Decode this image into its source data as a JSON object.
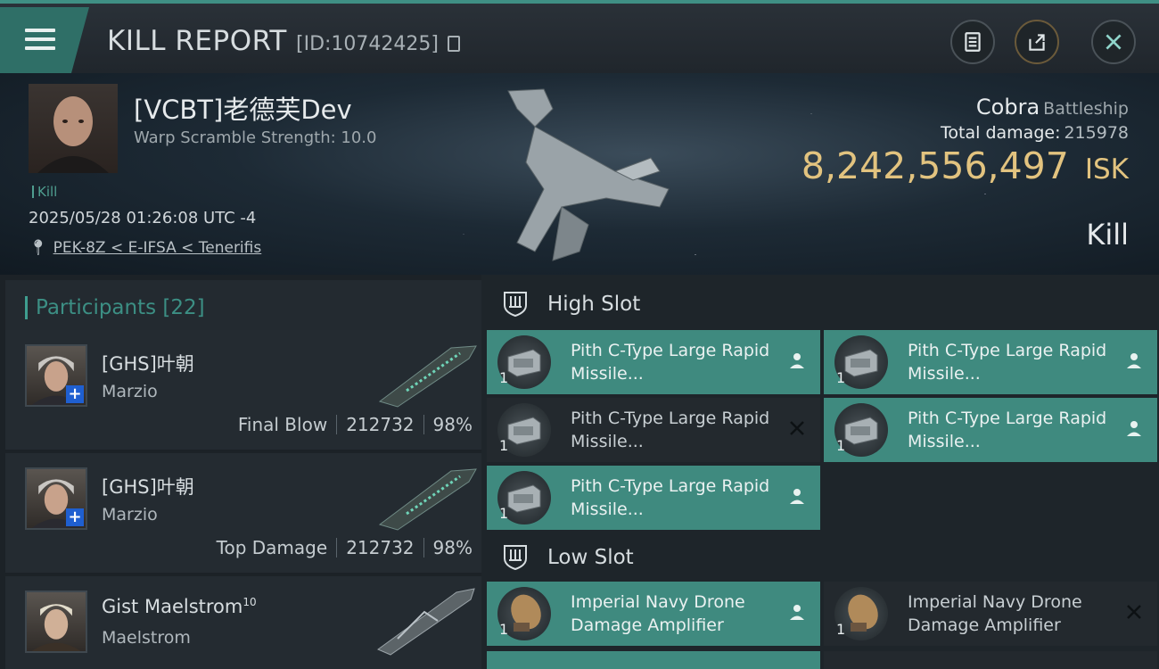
{
  "header": {
    "title": "KILL REPORT",
    "report_id": "[ID:10742425]"
  },
  "victim": {
    "name": "[VCBT]老德芙Dev",
    "warp_scramble": "Warp Scramble Strength: 10.0",
    "kill_tag": "Kill",
    "timestamp": "2025/05/28 01:26:08 UTC -4",
    "location": "PEK-8Z < E-IFSA < Tenerifis",
    "ship_name": "Cobra",
    "ship_class": "Battleship",
    "total_damage_label": "Total damage:",
    "total_damage": "215978",
    "isk_value": "8,242,556,497",
    "isk_unit": "ISK",
    "result": "Kill"
  },
  "participants": {
    "label": "Participants",
    "count": "[22]",
    "rows": [
      {
        "name": "[GHS]叶朝",
        "ship": "Marzio",
        "role": "Final Blow",
        "damage": "212732",
        "percent": "98%"
      },
      {
        "name": "[GHS]叶朝",
        "ship": "Marzio",
        "role": "Top Damage",
        "damage": "212732",
        "percent": "98%"
      },
      {
        "name": "Gist Maelstrom",
        "name_sup": "10",
        "ship": "Maelstrom"
      }
    ]
  },
  "slots": {
    "high": {
      "label": "High Slot",
      "modules": [
        {
          "name": "Pith C-Type Large Rapid Missile...",
          "qty": "1",
          "status": "person",
          "state": "fitted"
        },
        {
          "name": "Pith C-Type Large Rapid Missile...",
          "qty": "1",
          "status": "person",
          "state": "fitted"
        },
        {
          "name": "Pith C-Type Large Rapid Missile...",
          "qty": "1",
          "status": "x",
          "state": "destroyed"
        },
        {
          "name": "Pith C-Type Large Rapid Missile...",
          "qty": "1",
          "status": "person",
          "state": "fitted"
        },
        {
          "name": "Pith C-Type Large Rapid Missile...",
          "qty": "1",
          "status": "person",
          "state": "fitted"
        }
      ]
    },
    "low": {
      "label": "Low Slot",
      "modules": [
        {
          "name": "Imperial Navy Drone Damage Amplifier",
          "qty": "1",
          "status": "person",
          "state": "fitted"
        },
        {
          "name": "Imperial Navy Drone Damage Amplifier",
          "qty": "1",
          "status": "x",
          "state": "destroyed"
        }
      ]
    }
  },
  "colors": {
    "accent": "#3f8a7f",
    "isk": "#e2c37f"
  }
}
